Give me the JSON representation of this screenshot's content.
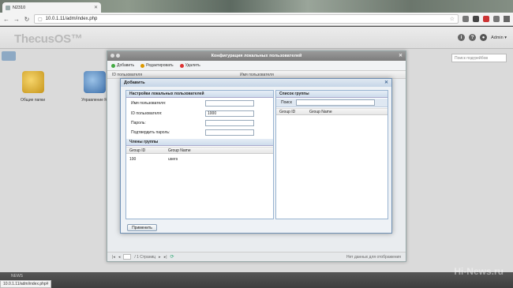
{
  "browser": {
    "tab_title": "N2310",
    "url": "10.0.1.11/adm/index.php",
    "status_url": "10.0.1.11/adm/index.php#"
  },
  "app": {
    "logo": "ThecusOS™",
    "user": "Admin ▾",
    "search_placeholder": "Поиск подгрейбов",
    "desktop_icons": [
      {
        "label": "Общие папки",
        "icon": "shared-folders-icon"
      },
      {
        "label": "Управление R",
        "icon": "user-management-icon"
      }
    ]
  },
  "main_window": {
    "title": "Конфигурация локальных пользователей",
    "toolbar": {
      "add": "Добавить",
      "edit": "Редактировать",
      "delete": "Удалить"
    },
    "columns": [
      "ID пользователя",
      "Имя пользователя"
    ],
    "pager": {
      "page_text": "/ 1 Страниц",
      "empty_text": "Нет данных для отображения"
    }
  },
  "dialog": {
    "title": "Добавить",
    "left_panel_title": "Настройки локальных пользователей",
    "fields": [
      {
        "label": "Имя пользователя:",
        "value": ""
      },
      {
        "label": "ID пользователя:",
        "value": "1000"
      },
      {
        "label": "Пароль:",
        "value": ""
      },
      {
        "label": "Подтвердить пароль:",
        "value": ""
      }
    ],
    "members_title": "Члены группы",
    "members_columns": [
      "Group ID",
      "Group Name"
    ],
    "members_rows": [
      {
        "id": "100",
        "name": "users"
      }
    ],
    "right_panel_title": "Список группы",
    "search_label": "Поиск",
    "group_columns": [
      "Group ID",
      "Group Name"
    ],
    "apply_button": "Применить"
  },
  "taskbar": {
    "left_text": "NEWS"
  },
  "watermark": "Hi-News.ru"
}
